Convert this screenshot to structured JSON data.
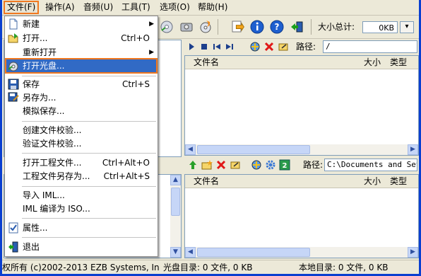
{
  "menubar": {
    "items": [
      {
        "label": "文件(F)"
      },
      {
        "label": "操作(A)"
      },
      {
        "label": "音频(U)"
      },
      {
        "label": "工具(T)"
      },
      {
        "label": "选项(O)"
      },
      {
        "label": "帮助(H)"
      }
    ]
  },
  "toolbar": {
    "size_label": "大小总计:",
    "size_value": "0KB"
  },
  "iso_pane": {
    "path_label": "路径:",
    "path_value": "/",
    "col_name": "文件名",
    "col_size": "大小",
    "col_type": "类型"
  },
  "local_pane": {
    "path_label": "路径:",
    "path_value": "C:\\Documents and Sett",
    "col_name": "文件名",
    "col_size": "大小",
    "col_type": "类型"
  },
  "file_menu": {
    "items": [
      {
        "label": "新建",
        "shortcut": "",
        "submenu": true
      },
      {
        "label": "打开...",
        "shortcut": "Ctrl+O",
        "submenu": false
      },
      {
        "label": "重新打开",
        "shortcut": "",
        "submenu": true
      },
      {
        "label": "打开光盘...",
        "shortcut": "",
        "submenu": false
      },
      {
        "label": "保存",
        "shortcut": "Ctrl+S",
        "submenu": false
      },
      {
        "label": "另存为...",
        "shortcut": "",
        "submenu": false
      },
      {
        "label": "模拟保存...",
        "shortcut": "",
        "submenu": false
      },
      {
        "label": "创建文件校验...",
        "shortcut": "",
        "submenu": false
      },
      {
        "label": "验证文件校验...",
        "shortcut": "",
        "submenu": false
      },
      {
        "label": "打开工程文件...",
        "shortcut": "Ctrl+Alt+O",
        "submenu": false
      },
      {
        "label": "工程文件另存为...",
        "shortcut": "Ctrl+Alt+S",
        "submenu": false
      },
      {
        "label": "导入 IML...",
        "shortcut": "",
        "submenu": false
      },
      {
        "label": "IML 编译为 ISO...",
        "shortcut": "",
        "submenu": false
      },
      {
        "label": "属性...",
        "shortcut": "",
        "submenu": false
      },
      {
        "label": "退出",
        "shortcut": "",
        "submenu": false
      }
    ]
  },
  "status": {
    "copyright": "权所有 (c)2002-2013 EZB Systems, In",
    "disc_dir": "光盘目录: 0 文件, 0 KB",
    "local_dir": "本地目录: 0 文件, 0 KB"
  },
  "colors": {
    "menu_highlight": "#316ac5",
    "focus_outline": "#f07820",
    "window_border": "#0a3fd0"
  }
}
